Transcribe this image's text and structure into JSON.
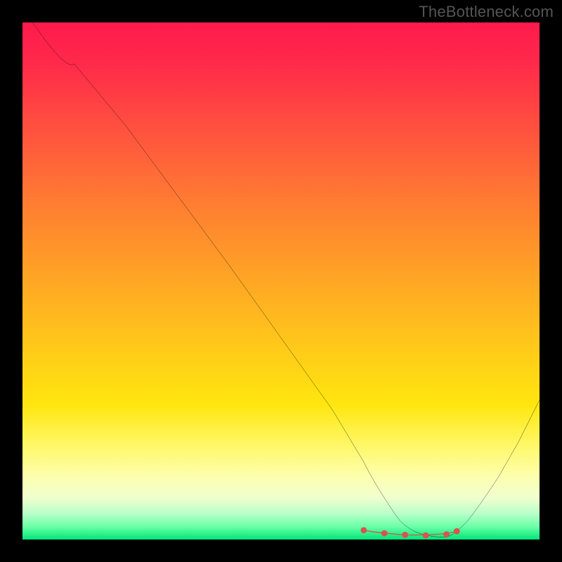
{
  "watermark": "TheBottleneck.com",
  "chart_data": {
    "type": "line",
    "title": "",
    "xlabel": "",
    "ylabel": "",
    "xlim": [
      0,
      100
    ],
    "ylim": [
      0,
      100
    ],
    "series": [
      {
        "name": "curve",
        "x": [
          2,
          10,
          20,
          30,
          40,
          50,
          60,
          66,
          70,
          72,
          74,
          76,
          78,
          80,
          82,
          84,
          88,
          92,
          96,
          100
        ],
        "values": [
          100,
          92,
          80,
          66.5,
          53,
          39,
          25,
          15,
          8,
          5,
          3,
          1.5,
          0.7,
          0.4,
          0.5,
          1.5,
          6,
          12,
          19,
          27
        ]
      },
      {
        "name": "highlight-band",
        "x": [
          66,
          70,
          74,
          78,
          82,
          84
        ],
        "values": [
          1.8,
          1.2,
          0.9,
          0.8,
          1.0,
          1.6
        ]
      }
    ],
    "colors": {
      "curve": "#000000",
      "highlight": "#d9534f"
    },
    "gradient_stops": [
      {
        "pos": 0,
        "color": "#ff1a4d"
      },
      {
        "pos": 0.5,
        "color": "#ffa126"
      },
      {
        "pos": 0.82,
        "color": "#fff86a"
      },
      {
        "pos": 1.0,
        "color": "#00e676"
      }
    ]
  }
}
